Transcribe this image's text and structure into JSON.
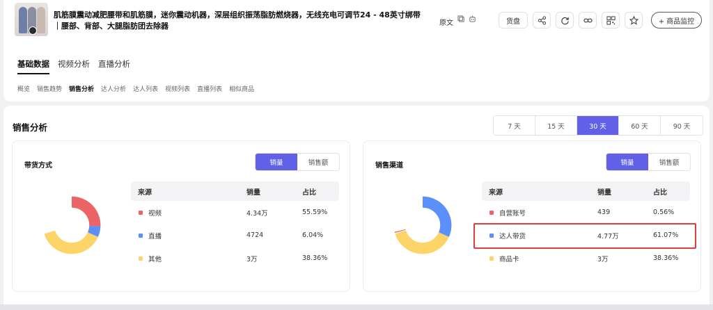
{
  "product": {
    "title": "肌筋膜震动减肥腰带和肌筋膜，迷你震动机器，深层组织振荡脂肪燃烧器，无线充电可调节24 - 48英寸绑带｜腰部、背部、大腿脂肪团去除器",
    "original_label": "原文"
  },
  "toolbar": {
    "inventory_label": "货盘",
    "monitor_label": "+ 商品监控",
    "icons": [
      "share-icon",
      "refresh-icon",
      "link-icon",
      "qr-code-icon",
      "star-icon"
    ]
  },
  "main_tabs": [
    {
      "label": "基础数据",
      "active": true
    },
    {
      "label": "视频分析",
      "active": false
    },
    {
      "label": "直播分析",
      "active": false
    }
  ],
  "sub_tabs": [
    {
      "label": "概览",
      "active": false
    },
    {
      "label": "销售趋势",
      "active": false
    },
    {
      "label": "销售分析",
      "active": true
    },
    {
      "label": "达人分析",
      "active": false
    },
    {
      "label": "达人列表",
      "active": false
    },
    {
      "label": "视频列表",
      "active": false
    },
    {
      "label": "直播列表",
      "active": false
    },
    {
      "label": "相似商品",
      "active": false
    }
  ],
  "section": {
    "title": "销售分析",
    "ranges": [
      "7 天",
      "15 天",
      "30 天",
      "60 天",
      "90 天"
    ],
    "selected_range": "30 天"
  },
  "cards": [
    {
      "title": "带货方式",
      "toggle": [
        "销量",
        "销售额"
      ],
      "toggle_selected": "销量",
      "headers": [
        "来源",
        "销量",
        "占比"
      ],
      "rows": [
        {
          "source": "视频",
          "sales": "4.34万",
          "share": "55.59%",
          "color": "#ec6466",
          "pct": 55.59
        },
        {
          "source": "直播",
          "sales": "4724",
          "share": "6.04%",
          "color": "#5b8ff9",
          "pct": 6.04
        },
        {
          "source": "其他",
          "sales": "3万",
          "share": "38.36%",
          "color": "#fcd468",
          "pct": 38.36
        }
      ]
    },
    {
      "title": "销售渠道",
      "toggle": [
        "销量",
        "销售额"
      ],
      "toggle_selected": "销量",
      "headers": [
        "来源",
        "销量",
        "占比"
      ],
      "rows": [
        {
          "source": "自营账号",
          "sales": "439",
          "share": "0.56%",
          "color": "#ec6466",
          "pct": 0.56
        },
        {
          "source": "达人带货",
          "sales": "4.77万",
          "share": "61.07%",
          "color": "#5b8ff9",
          "pct": 61.07,
          "highlighted": true
        },
        {
          "source": "商品卡",
          "sales": "3万",
          "share": "38.36%",
          "color": "#fcd468",
          "pct": 38.36
        }
      ]
    }
  ],
  "colors": {
    "accent": "#6161e8",
    "highlight": "#e03c3c"
  }
}
